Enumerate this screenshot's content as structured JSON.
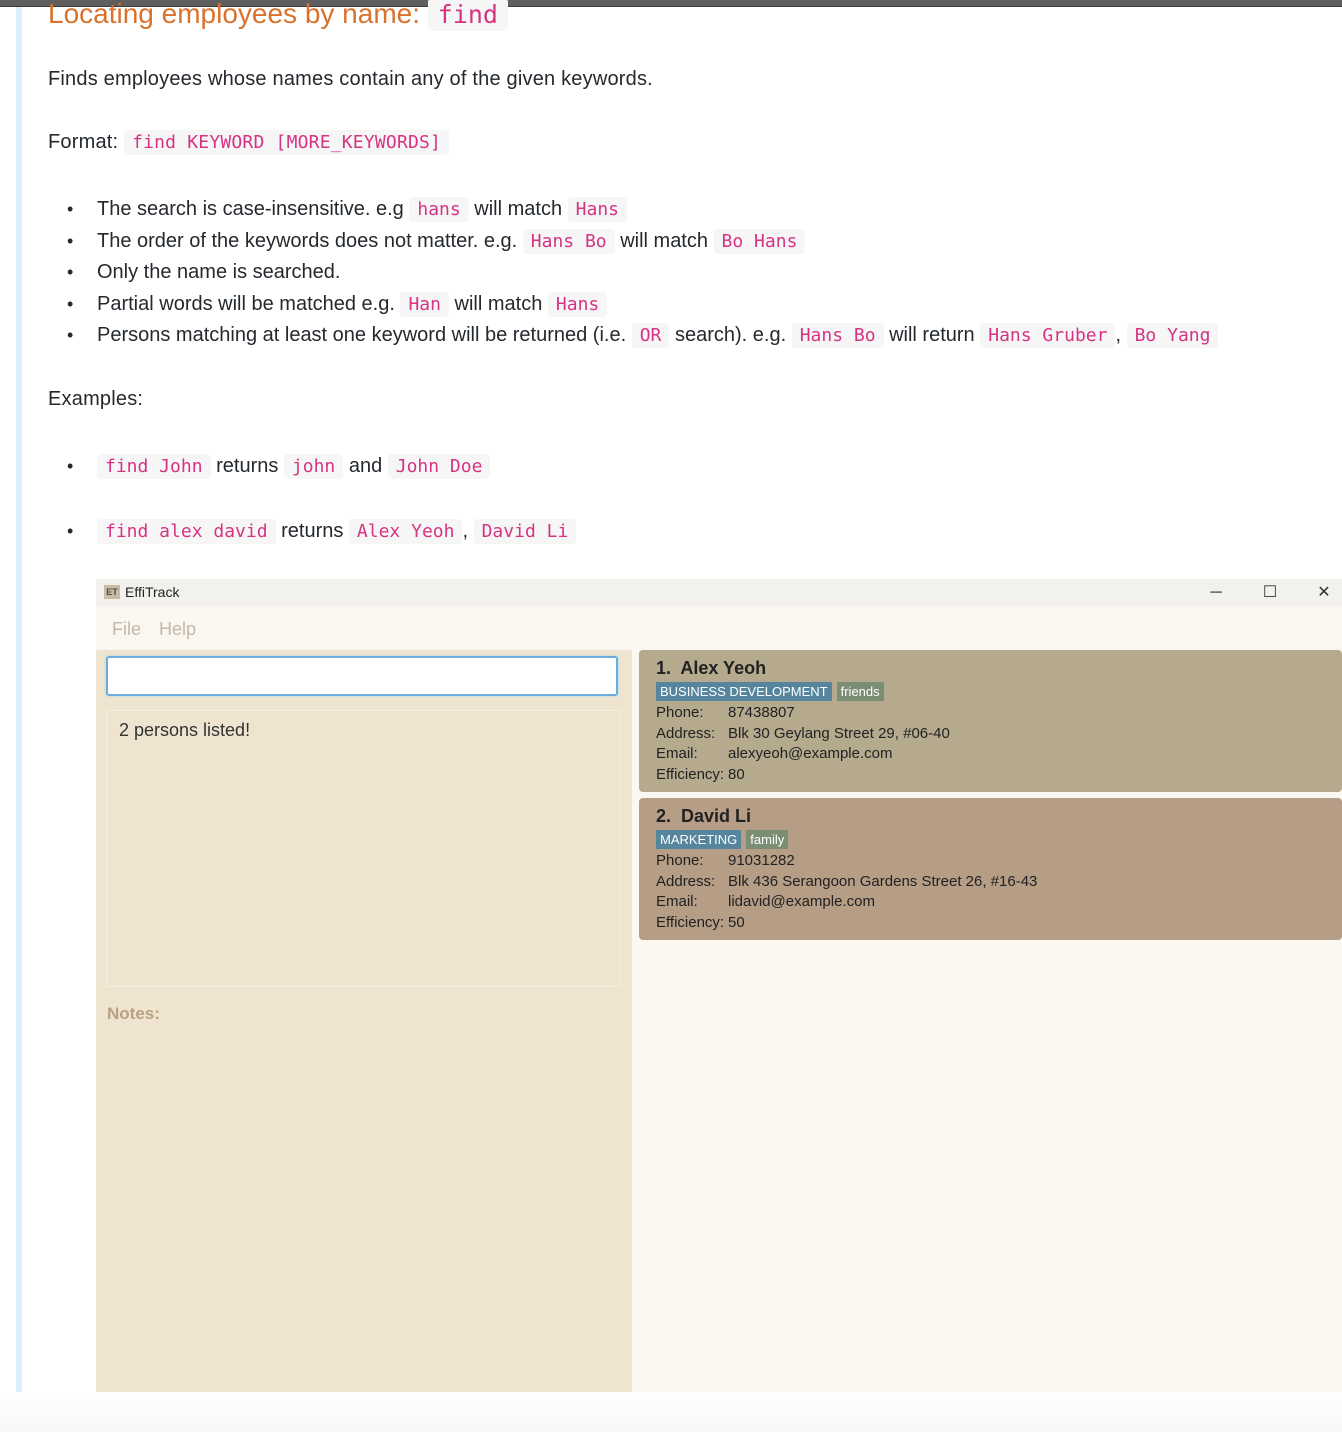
{
  "heading": {
    "text": "Locating employees by name:",
    "code": "find"
  },
  "description": "Finds employees whose names contain any of the given keywords.",
  "format": {
    "label": "Format:",
    "code": "find KEYWORD [MORE_KEYWORDS]"
  },
  "rules": [
    {
      "parts": [
        {
          "t": "The search is case-insensitive. e.g "
        },
        {
          "c": "hans"
        },
        {
          "t": " will match "
        },
        {
          "c": "Hans"
        }
      ]
    },
    {
      "parts": [
        {
          "t": "The order of the keywords does not matter. e.g. "
        },
        {
          "c": "Hans Bo"
        },
        {
          "t": " will match "
        },
        {
          "c": "Bo Hans"
        }
      ]
    },
    {
      "parts": [
        {
          "t": "Only the name is searched."
        }
      ]
    },
    {
      "parts": [
        {
          "t": "Partial words will be matched e.g. "
        },
        {
          "c": "Han"
        },
        {
          "t": " will match "
        },
        {
          "c": "Hans"
        }
      ]
    },
    {
      "parts": [
        {
          "t": "Persons matching at least one keyword will be returned (i.e. "
        },
        {
          "c": "OR"
        },
        {
          "t": " search). e.g. "
        },
        {
          "c": "Hans Bo"
        },
        {
          "t": " will return "
        },
        {
          "c": "Hans Gruber"
        },
        {
          "t": ", "
        },
        {
          "c": "Bo Yang"
        }
      ]
    }
  ],
  "examples_label": "Examples:",
  "examples": [
    {
      "parts": [
        {
          "c": "find John"
        },
        {
          "t": " returns "
        },
        {
          "c": "john"
        },
        {
          "t": " and "
        },
        {
          "c": "John Doe"
        }
      ]
    },
    {
      "parts": [
        {
          "c": "find alex david"
        },
        {
          "t": " returns "
        },
        {
          "c": "Alex Yeoh"
        },
        {
          "t": ", "
        },
        {
          "c": "David Li"
        }
      ]
    }
  ],
  "app": {
    "icon_text": "ET",
    "title": "EffiTrack",
    "window_controls": {
      "minimize": "─",
      "maximize": "☐",
      "close": "✕"
    },
    "menu": [
      "File",
      "Help"
    ],
    "command_input": {
      "value": "",
      "placeholder": ""
    },
    "result_text": "2 persons listed!",
    "notes_label": "Notes:",
    "field_labels": {
      "phone": "Phone:",
      "address": "Address:",
      "email": "Email:",
      "efficiency": "Efficiency:"
    },
    "persons": [
      {
        "index": "1.",
        "name": "Alex Yeoh",
        "department": "BUSINESS DEVELOPMENT",
        "tag": "friends",
        "phone": "87438807",
        "address": "Blk 30 Geylang Street 29, #06-40",
        "email": "alexyeoh@example.com",
        "efficiency": "80",
        "card_color": "#b5aa8e"
      },
      {
        "index": "2.",
        "name": "David Li",
        "department": "MARKETING",
        "tag": "family",
        "phone": "91031282",
        "address": "Blk 436 Serangoon Gardens Street 26, #16-43",
        "email": "lidavid@example.com",
        "efficiency": "50",
        "card_color": "#b59d86"
      }
    ]
  }
}
